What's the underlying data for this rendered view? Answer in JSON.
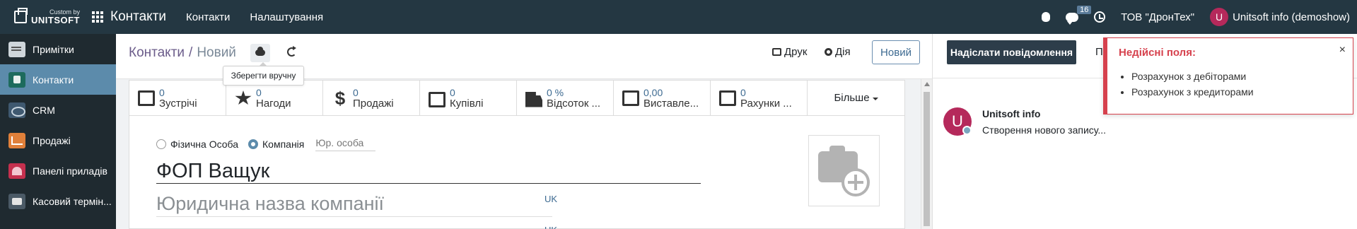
{
  "brand": {
    "sub": "Custom by",
    "name": "UNITSOFT"
  },
  "app_title": "Контакти",
  "top_menu": [
    "Контакти",
    "Налаштування"
  ],
  "top_right": {
    "messages_count": "16",
    "company": "ТОВ \"ДронТех\"",
    "user_initial": "U",
    "user_name": "Unitsoft info (demoshow)"
  },
  "sidebar": {
    "items": [
      {
        "label": "Примітки",
        "icon": "notes-icon"
      },
      {
        "label": "Контакти",
        "icon": "contacts-icon",
        "active": true
      },
      {
        "label": "CRM",
        "icon": "crm-icon"
      },
      {
        "label": "Продажі",
        "icon": "sales-icon"
      },
      {
        "label": "Панелі приладів",
        "icon": "dashboard-icon"
      },
      {
        "label": "Касовий термін...",
        "icon": "pos-icon"
      }
    ]
  },
  "breadcrumb": {
    "parent": "Контакти",
    "sep": "/",
    "current": "Новий"
  },
  "tooltip": "Зберегти вручну",
  "toolbar": {
    "print": "Друк",
    "action": "Дія",
    "new": "Новий"
  },
  "smart_buttons": [
    {
      "value": "0",
      "label": "Зустрічі",
      "icon": "calendar-icon"
    },
    {
      "value": "0",
      "label": "Нагоди",
      "icon": "star-icon"
    },
    {
      "value": "0",
      "label": "Продажі",
      "icon": "dollar-icon"
    },
    {
      "value": "0",
      "label": "Купівлі",
      "icon": "credit-card-icon"
    },
    {
      "value": "0 %",
      "label": "Відсоток ...",
      "icon": "truck-icon"
    },
    {
      "value": "0,00",
      "label": "Виставле...",
      "icon": "edit-icon"
    },
    {
      "value": "0",
      "label": "Рахунки ...",
      "icon": "edit-icon"
    }
  ],
  "more": "Більше",
  "form": {
    "type_individual": "Фізична Особа",
    "type_company": "Компанія",
    "legal_person": "Юр. особа",
    "name": "ФОП Ващук",
    "legal_name_placeholder": "Юридична назва компанії",
    "lang1": "UK",
    "lang2": "UK"
  },
  "chatter": {
    "send_message": "Надіслати повідомлення",
    "log_note": "П",
    "author": "Unitsoft info",
    "author_initial": "U",
    "body": "Створення нового запису..."
  },
  "notification": {
    "title": "Недійсні поля:",
    "close": "×",
    "items": [
      "Розрахунок з дебіторами",
      "Розрахунок з кредиторами"
    ]
  },
  "colors": {
    "navbar": "#243742",
    "sidebar": "#1f2a30",
    "active": "#5c8bab",
    "error": "#d6414d",
    "avatar": "#b5295b"
  }
}
